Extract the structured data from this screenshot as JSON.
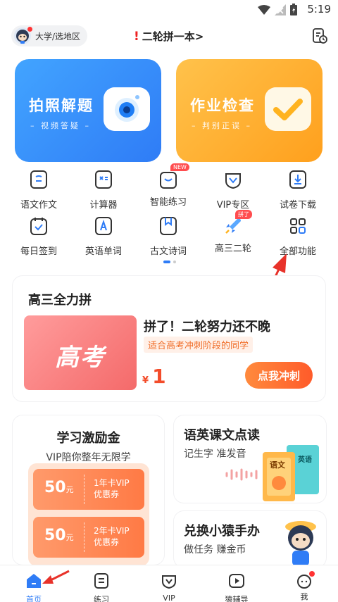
{
  "status_bar": {
    "time": "5:19"
  },
  "top_bar": {
    "region_label": "大学/选地区",
    "title": "二轮拼一本>"
  },
  "hero_cards": [
    {
      "title": "拍照解题",
      "subtitle": "– 视频答疑 –"
    },
    {
      "title": "作业检查",
      "subtitle": "– 判别正误 –"
    }
  ],
  "features": [
    {
      "label": "语文作文",
      "icon": "essay-icon"
    },
    {
      "label": "计算器",
      "icon": "calculator-icon"
    },
    {
      "label": "智能练习",
      "icon": "smart-practice-icon",
      "badge": "NEW"
    },
    {
      "label": "VIP专区",
      "icon": "vip-icon"
    },
    {
      "label": "试卷下载",
      "icon": "download-icon"
    },
    {
      "label": "每日签到",
      "icon": "checkin-icon"
    },
    {
      "label": "英语单词",
      "icon": "english-word-icon"
    },
    {
      "label": "古文诗词",
      "icon": "poetry-icon"
    },
    {
      "label": "高三二轮",
      "icon": "rocket-icon",
      "badge": "拼了"
    },
    {
      "label": "全部功能",
      "icon": "all-functions-icon"
    }
  ],
  "sprint": {
    "section_title": "高三全力拼",
    "image_text": "高考",
    "headline": "拼了！二轮努力还不晚",
    "tag": "适合高考冲刺阶段的同学",
    "currency": "¥",
    "price": "1",
    "button": "点我冲刺"
  },
  "incentive": {
    "title": "学习激励金",
    "subtitle": "VIP陪你整年无限学",
    "coupons": [
      {
        "amount": "50",
        "unit": "元",
        "line1": "1年卡VIP",
        "line2": "优惠券"
      },
      {
        "amount": "50",
        "unit": "元",
        "line1": "2年卡VIP",
        "line2": "优惠券"
      }
    ]
  },
  "reading": {
    "title": "语英课文点读",
    "subtitle": "记生字 准发音",
    "book1": "语文",
    "book2": "英语"
  },
  "exchange": {
    "title": "兑换小猿手办",
    "subtitle": "做任务 赚金币"
  },
  "tabs": [
    {
      "label": "首页",
      "icon": "home-icon",
      "active": true
    },
    {
      "label": "练习",
      "icon": "practice-icon"
    },
    {
      "label": "VIP",
      "icon": "vip-tab-icon"
    },
    {
      "label": "猿辅导",
      "icon": "video-icon"
    },
    {
      "label": "我",
      "icon": "profile-icon",
      "dot": true
    }
  ],
  "colors": {
    "accent": "#2f7cf6",
    "orange": "#ff7a45",
    "red_arrow": "#e8322a"
  }
}
